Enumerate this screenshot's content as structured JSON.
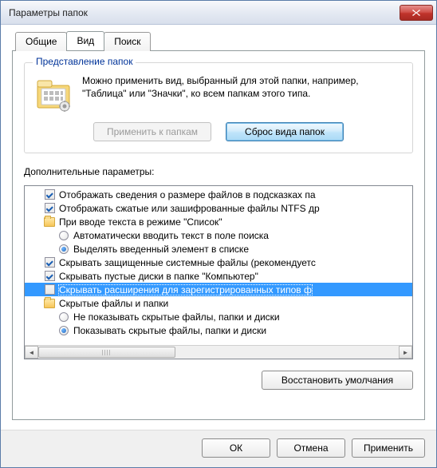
{
  "window": {
    "title": "Параметры папок"
  },
  "tabs": {
    "general": "Общие",
    "view": "Вид",
    "search": "Поиск",
    "active": "view"
  },
  "folderViews": {
    "title": "Представление папок",
    "description": "Можно применить вид, выбранный для этой папки, например, \"Таблица\" или \"Значки\", ко всем папкам этого типа.",
    "applyBtn": "Применить к папкам",
    "resetBtn": "Сброс вида папок"
  },
  "advanced": {
    "label": "Дополнительные параметры:",
    "items": [
      {
        "type": "checkbox",
        "checked": true,
        "indent": 0,
        "label": "Отображать сведения о размере файлов в подсказках па"
      },
      {
        "type": "checkbox",
        "checked": true,
        "indent": 0,
        "label": "Отображать сжатые или зашифрованные файлы NTFS др"
      },
      {
        "type": "folder",
        "indent": 0,
        "label": "При вводе текста в режиме \"Список\""
      },
      {
        "type": "radio",
        "checked": false,
        "indent": 1,
        "label": "Автоматически вводить текст в поле поиска"
      },
      {
        "type": "radio",
        "checked": true,
        "indent": 1,
        "label": "Выделять введенный элемент в списке"
      },
      {
        "type": "checkbox",
        "checked": true,
        "indent": 0,
        "label": "Скрывать защищенные системные файлы (рекомендуетс"
      },
      {
        "type": "checkbox",
        "checked": true,
        "indent": 0,
        "label": "Скрывать пустые диски в папке \"Компьютер\""
      },
      {
        "type": "checkbox",
        "checked": false,
        "indent": 0,
        "label": "Скрывать расширения для зарегистрированных типов ф",
        "selected": true
      },
      {
        "type": "folder",
        "indent": 0,
        "label": "Скрытые файлы и папки"
      },
      {
        "type": "radio",
        "checked": false,
        "indent": 1,
        "label": "Не показывать скрытые файлы, папки и диски"
      },
      {
        "type": "radio",
        "checked": true,
        "indent": 1,
        "label": "Показывать скрытые файлы, папки и диски"
      }
    ],
    "restoreBtn": "Восстановить умолчания"
  },
  "dialogButtons": {
    "ok": "ОК",
    "cancel": "Отмена",
    "apply": "Применить"
  }
}
